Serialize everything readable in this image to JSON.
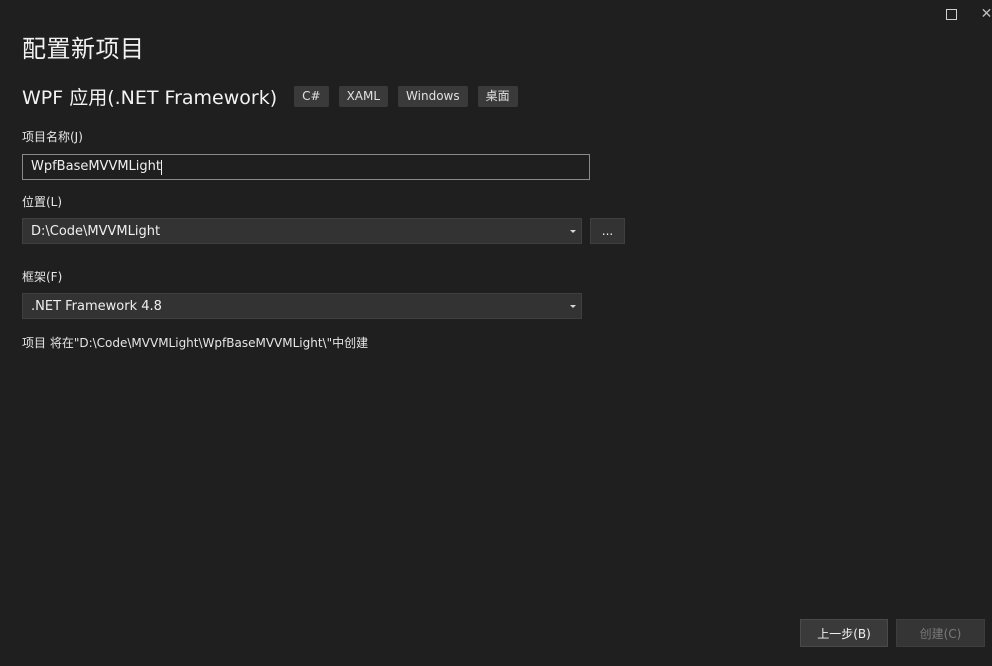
{
  "window": {
    "maximize_icon": "maximize-icon",
    "close_icon": "close-icon"
  },
  "page": {
    "title": "配置新项目"
  },
  "template": {
    "name": "WPF 应用(.NET Framework)",
    "tags": [
      "C#",
      "XAML",
      "Windows",
      "桌面"
    ]
  },
  "project_name": {
    "label": "项目名称(J)",
    "value": "WpfBaseMVVMLight"
  },
  "location": {
    "label": "位置(L)",
    "value": "D:\\Code\\MVVMLight",
    "browse_label": "..."
  },
  "framework": {
    "label": "框架(F)",
    "value": ".NET Framework 4.8"
  },
  "info": {
    "text": "项目 将在\"D:\\Code\\MVVMLight\\WpfBaseMVVMLight\\\"中创建"
  },
  "buttons": {
    "back": "上一步(B)",
    "create": "创建(C)"
  },
  "colors": {
    "background": "#1f1f1f",
    "input_border": "#8a8a8a",
    "combo_bg": "#333333",
    "tag_bg": "#3a3a3a",
    "disabled_text": "#7a7a7a"
  }
}
